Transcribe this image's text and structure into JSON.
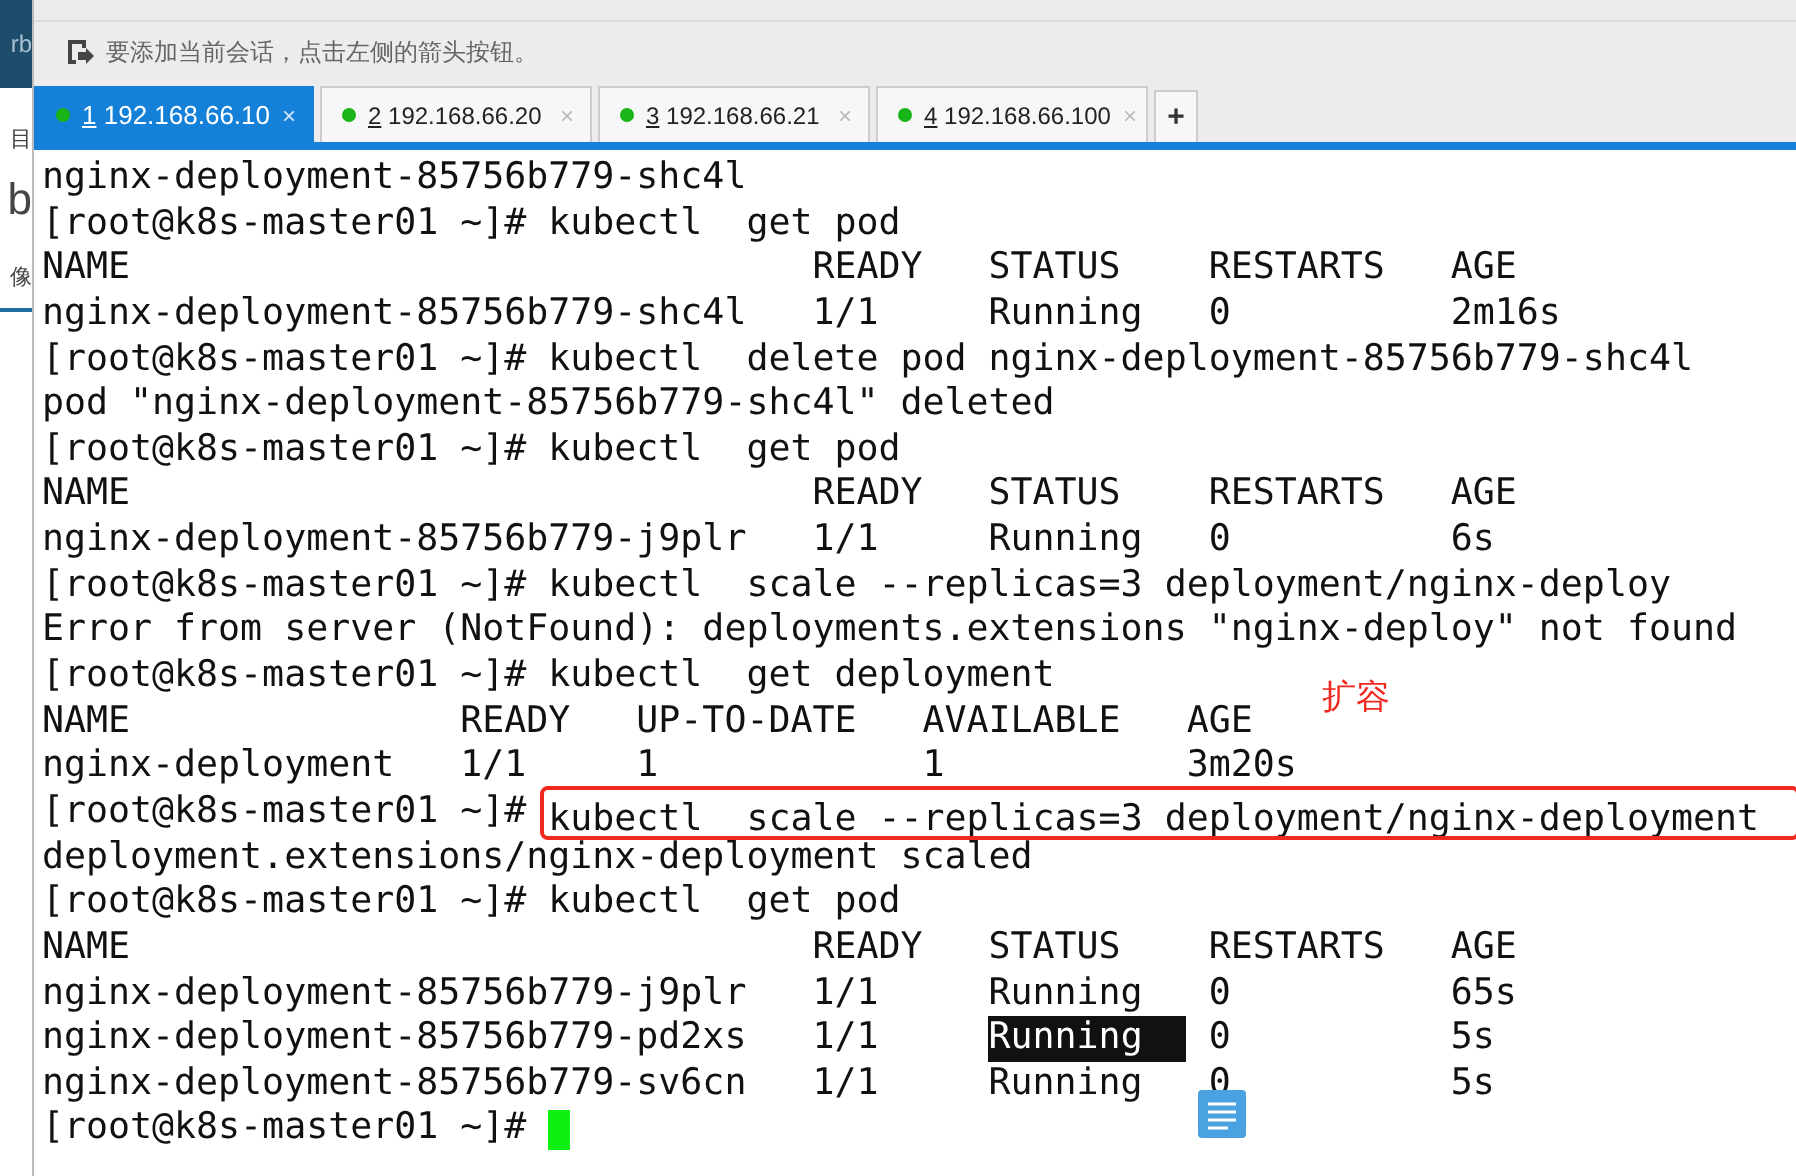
{
  "side_fragments": {
    "top": "rb",
    "items": [
      "目",
      "b",
      "像"
    ]
  },
  "hint": {
    "text": "要添加当前会话，点击左侧的箭头按钮。"
  },
  "tabs": [
    {
      "number": "1",
      "label": "192.168.66.10",
      "close": "×",
      "selected": true
    },
    {
      "number": "2",
      "label": "192.168.66.20",
      "close": "×",
      "selected": false
    },
    {
      "number": "3",
      "label": "192.168.66.21",
      "close": "×",
      "selected": false
    },
    {
      "number": "4",
      "label": "192.168.66.100",
      "close": "×",
      "selected": false
    }
  ],
  "new_tab": "+",
  "terminal": {
    "lines": [
      {
        "kind": "plain",
        "text": "nginx-deployment-85756b779-shc4l"
      },
      {
        "kind": "plain",
        "text": "[root@k8s-master01 ~]# kubectl  get pod"
      },
      {
        "kind": "plain",
        "text": "NAME                               READY   STATUS    RESTARTS   AGE"
      },
      {
        "kind": "plain",
        "text": "nginx-deployment-85756b779-shc4l   1/1     Running   0          2m16s"
      },
      {
        "kind": "plain",
        "text": "[root@k8s-master01 ~]# kubectl  delete pod nginx-deployment-85756b779-shc4l"
      },
      {
        "kind": "plain",
        "text": "pod \"nginx-deployment-85756b779-shc4l\" deleted"
      },
      {
        "kind": "plain",
        "text": "[root@k8s-master01 ~]# kubectl  get pod"
      },
      {
        "kind": "plain",
        "text": "NAME                               READY   STATUS    RESTARTS   AGE"
      },
      {
        "kind": "plain",
        "text": "nginx-deployment-85756b779-j9plr   1/1     Running   0          6s"
      },
      {
        "kind": "plain",
        "text": "[root@k8s-master01 ~]# kubectl  scale --replicas=3 deployment/nginx-deploy"
      },
      {
        "kind": "plain",
        "text": "Error from server (NotFound): deployments.extensions \"nginx-deploy\" not found"
      },
      {
        "kind": "plain",
        "text": "[root@k8s-master01 ~]# kubectl  get deployment"
      },
      {
        "kind": "noted",
        "text": "NAME               READY   UP-TO-DATE   AVAILABLE   AGE",
        "note": "扩容"
      },
      {
        "kind": "plain",
        "text": "nginx-deployment   1/1     1            1           3m20s"
      },
      {
        "kind": "boxed",
        "parts": [
          "[root@k8s-master01 ~]# ",
          "kubectl  scale --replicas=3 deployment/nginx-deployment"
        ]
      },
      {
        "kind": "plain",
        "text": "deployment.extensions/nginx-deployment scaled"
      },
      {
        "kind": "plain",
        "text": "[root@k8s-master01 ~]# kubectl  get pod"
      },
      {
        "kind": "plain",
        "text": "NAME                               READY   STATUS    RESTARTS   AGE"
      },
      {
        "kind": "plain",
        "text": "nginx-deployment-85756b779-j9plr   1/1     Running   0          65s"
      },
      {
        "kind": "selected",
        "parts": [
          "nginx-deployment-85756b779-pd2xs   1/1     ",
          "Running  ",
          "0          5s"
        ]
      },
      {
        "kind": "plain",
        "text": "nginx-deployment-85756b779-sv6cn   1/1     Running   0          5s"
      },
      {
        "kind": "prompt",
        "text": "[root@k8s-master01 ~]# "
      }
    ]
  }
}
